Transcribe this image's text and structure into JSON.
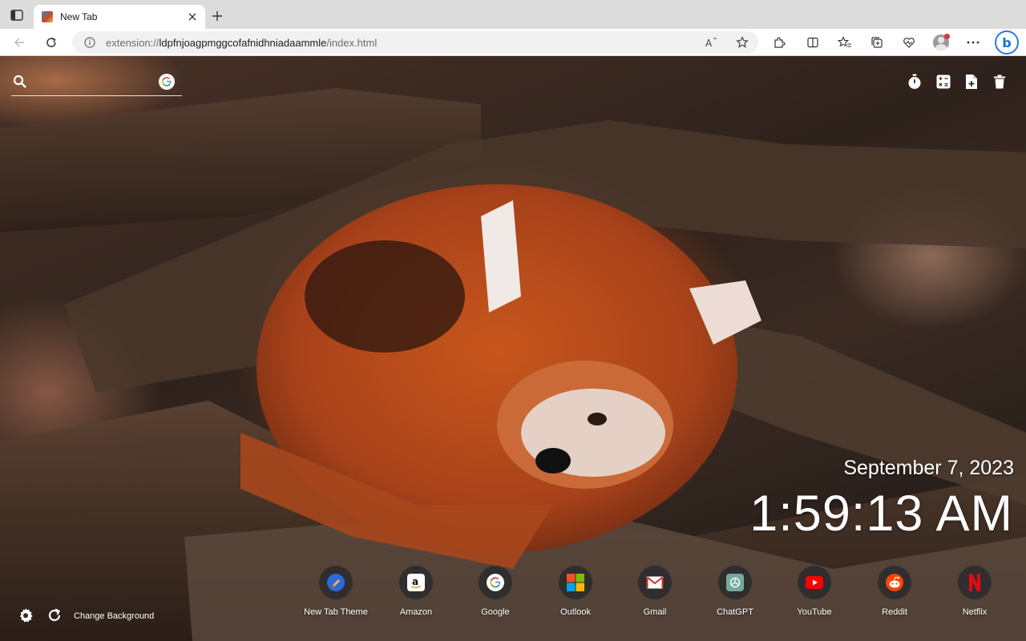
{
  "browser": {
    "tab": {
      "title": "New Tab"
    },
    "address": {
      "scheme": "extension://",
      "host": "ldpfnjoagpmggcofafnidhniadaammle",
      "path": "/index.html"
    }
  },
  "search": {
    "placeholder": "",
    "value": "",
    "engine_icon": "google-icon"
  },
  "tools": [
    "timer-icon",
    "calculator-icon",
    "add-note-icon",
    "trash-icon"
  ],
  "clock": {
    "date": "September 7, 2023",
    "time": "1:59:13 AM"
  },
  "background": {
    "change_label": "Change Background"
  },
  "shortcuts": [
    {
      "label": "New Tab Theme",
      "icon": "new-tab-theme-icon"
    },
    {
      "label": "Amazon",
      "icon": "amazon-icon"
    },
    {
      "label": "Google",
      "icon": "google-icon"
    },
    {
      "label": "Outlook",
      "icon": "outlook-icon"
    },
    {
      "label": "Gmail",
      "icon": "gmail-icon"
    },
    {
      "label": "ChatGPT",
      "icon": "chatgpt-icon"
    },
    {
      "label": "YouTube",
      "icon": "youtube-icon"
    },
    {
      "label": "Reddit",
      "icon": "reddit-icon"
    },
    {
      "label": "Netflix",
      "icon": "netflix-icon"
    }
  ],
  "colors": {
    "accent": "#2a7be4",
    "page_text": "#ffffff"
  }
}
